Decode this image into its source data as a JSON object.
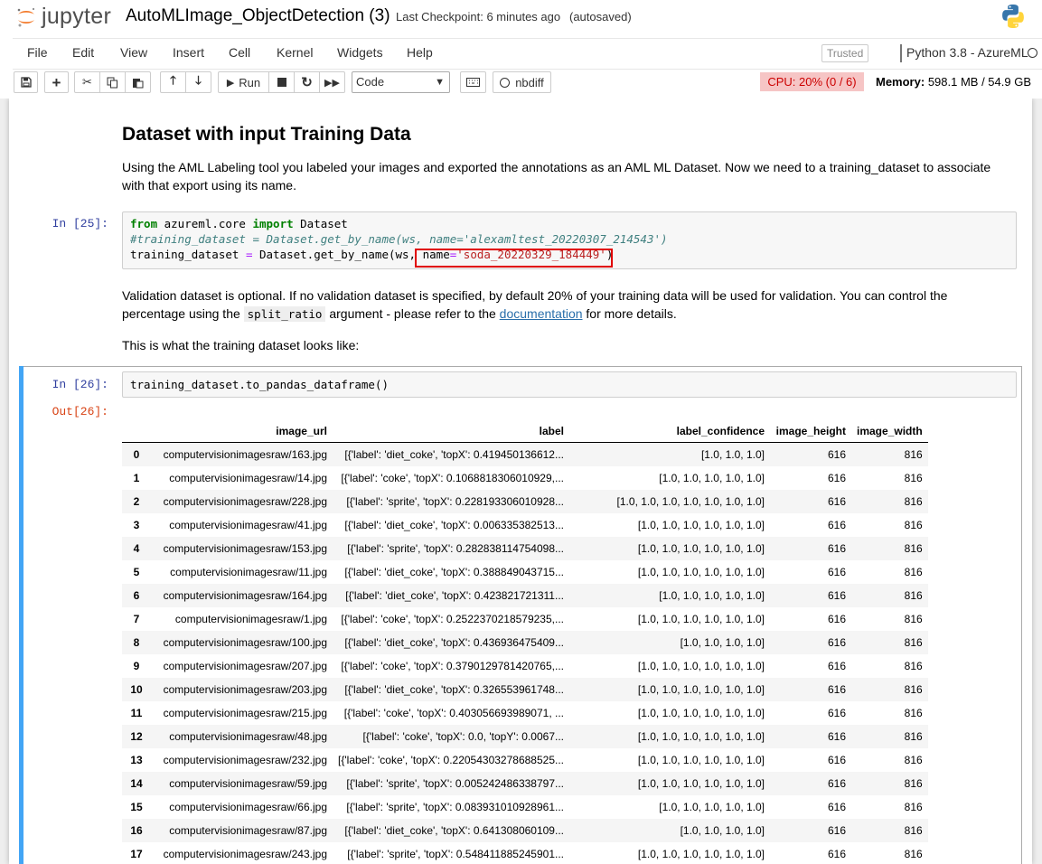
{
  "header": {
    "logo_text": "jupyter",
    "notebook_name": "AutoMLImage_ObjectDetection (3)",
    "checkpoint": "Last Checkpoint: 6 minutes ago",
    "autosave": "(autosaved)"
  },
  "menu": {
    "items": [
      "File",
      "Edit",
      "View",
      "Insert",
      "Cell",
      "Kernel",
      "Widgets",
      "Help"
    ],
    "trusted": "Trusted",
    "kernel": "Python 3.8 - AzureML"
  },
  "toolbar": {
    "run_label": "Run",
    "cell_type": "Code",
    "nbdiff_label": "nbdiff",
    "cpu": "CPU: 20% (0 / 6)",
    "memory_label": "Memory:",
    "memory_value": "598.1 MB / 54.9 GB"
  },
  "notebook": {
    "heading": "Dataset with input Training Data",
    "para1_line1": "Using the AML Labeling tool you labeled your images and exported the annotations as an AML ML Dataset. Now we need to a training_dataset to associate",
    "para1_line2": "with that export using its name.",
    "cell25": {
      "prompt": "In [25]:",
      "kw_from": "from",
      "module": " azureml.core ",
      "kw_import": "import",
      "cls": " Dataset",
      "comment": "#training_dataset = Dataset.get_by_name(ws, name='alexamltest_20220307_214543')",
      "line3_pre": "training_dataset ",
      "line3_eq": "=",
      "line3_mid": " Dataset.get_by_name(ws, ",
      "line3_arg": "name",
      "line3_eq2": "=",
      "line3_str": "'soda_20220329_184449'",
      "line3_close": ")"
    },
    "para2_line1": "Validation dataset is optional. If no validation dataset is specified, by default 20% of your training data will be used for validation. You can control the",
    "para2_pre": "percentage using the ",
    "para2_code": "split_ratio",
    "para2_mid": " argument - please refer to the ",
    "para2_link": "documentation",
    "para2_post": " for more details.",
    "para3": "This is what the training dataset looks like:",
    "cell26": {
      "prompt": "In [26]:",
      "code": "training_dataset.to_pandas_dataframe()",
      "out_prompt": "Out[26]:"
    },
    "table": {
      "columns": [
        "",
        "image_url",
        "label",
        "label_confidence",
        "image_height",
        "image_width"
      ],
      "rows": [
        [
          "0",
          "computervisionimagesraw/163.jpg",
          "[{'label': 'diet_coke', 'topX': 0.419450136612...",
          "[1.0, 1.0, 1.0]",
          "616",
          "816"
        ],
        [
          "1",
          "computervisionimagesraw/14.jpg",
          "[{'label': 'coke', 'topX': 0.1068818306010929,...",
          "[1.0, 1.0, 1.0, 1.0, 1.0]",
          "616",
          "816"
        ],
        [
          "2",
          "computervisionimagesraw/228.jpg",
          "[{'label': 'sprite', 'topX': 0.228193306010928...",
          "[1.0, 1.0, 1.0, 1.0, 1.0, 1.0, 1.0]",
          "616",
          "816"
        ],
        [
          "3",
          "computervisionimagesraw/41.jpg",
          "[{'label': 'diet_coke', 'topX': 0.006335382513...",
          "[1.0, 1.0, 1.0, 1.0, 1.0, 1.0]",
          "616",
          "816"
        ],
        [
          "4",
          "computervisionimagesraw/153.jpg",
          "[{'label': 'sprite', 'topX': 0.282838114754098...",
          "[1.0, 1.0, 1.0, 1.0, 1.0, 1.0]",
          "616",
          "816"
        ],
        [
          "5",
          "computervisionimagesraw/11.jpg",
          "[{'label': 'diet_coke', 'topX': 0.388849043715...",
          "[1.0, 1.0, 1.0, 1.0, 1.0, 1.0]",
          "616",
          "816"
        ],
        [
          "6",
          "computervisionimagesraw/164.jpg",
          "[{'label': 'diet_coke', 'topX': 0.423821721311...",
          "[1.0, 1.0, 1.0, 1.0, 1.0]",
          "616",
          "816"
        ],
        [
          "7",
          "computervisionimagesraw/1.jpg",
          "[{'label': 'coke', 'topX': 0.2522370218579235,...",
          "[1.0, 1.0, 1.0, 1.0, 1.0, 1.0]",
          "616",
          "816"
        ],
        [
          "8",
          "computervisionimagesraw/100.jpg",
          "[{'label': 'diet_coke', 'topX': 0.436936475409...",
          "[1.0, 1.0, 1.0, 1.0]",
          "616",
          "816"
        ],
        [
          "9",
          "computervisionimagesraw/207.jpg",
          "[{'label': 'coke', 'topX': 0.3790129781420765,...",
          "[1.0, 1.0, 1.0, 1.0, 1.0, 1.0]",
          "616",
          "816"
        ],
        [
          "10",
          "computervisionimagesraw/203.jpg",
          "[{'label': 'diet_coke', 'topX': 0.326553961748...",
          "[1.0, 1.0, 1.0, 1.0, 1.0, 1.0]",
          "616",
          "816"
        ],
        [
          "11",
          "computervisionimagesraw/215.jpg",
          "[{'label': 'coke', 'topX': 0.403056693989071, ...",
          "[1.0, 1.0, 1.0, 1.0, 1.0, 1.0]",
          "616",
          "816"
        ],
        [
          "12",
          "computervisionimagesraw/48.jpg",
          "[{'label': 'coke', 'topX': 0.0, 'topY': 0.0067...",
          "[1.0, 1.0, 1.0, 1.0, 1.0, 1.0]",
          "616",
          "816"
        ],
        [
          "13",
          "computervisionimagesraw/232.jpg",
          "[{'label': 'coke', 'topX': 0.22054303278688525...",
          "[1.0, 1.0, 1.0, 1.0, 1.0, 1.0]",
          "616",
          "816"
        ],
        [
          "14",
          "computervisionimagesraw/59.jpg",
          "[{'label': 'sprite', 'topX': 0.005242486338797...",
          "[1.0, 1.0, 1.0, 1.0, 1.0, 1.0]",
          "616",
          "816"
        ],
        [
          "15",
          "computervisionimagesraw/66.jpg",
          "[{'label': 'sprite', 'topX': 0.083931010928961...",
          "[1.0, 1.0, 1.0, 1.0, 1.0]",
          "616",
          "816"
        ],
        [
          "16",
          "computervisionimagesraw/87.jpg",
          "[{'label': 'diet_coke', 'topX': 0.641308060109...",
          "[1.0, 1.0, 1.0, 1.0]",
          "616",
          "816"
        ],
        [
          "17",
          "computervisionimagesraw/243.jpg",
          "[{'label': 'sprite', 'topX': 0.548411885245901...",
          "[1.0, 1.0, 1.0, 1.0, 1.0, 1.0]",
          "616",
          "816"
        ]
      ]
    }
  }
}
